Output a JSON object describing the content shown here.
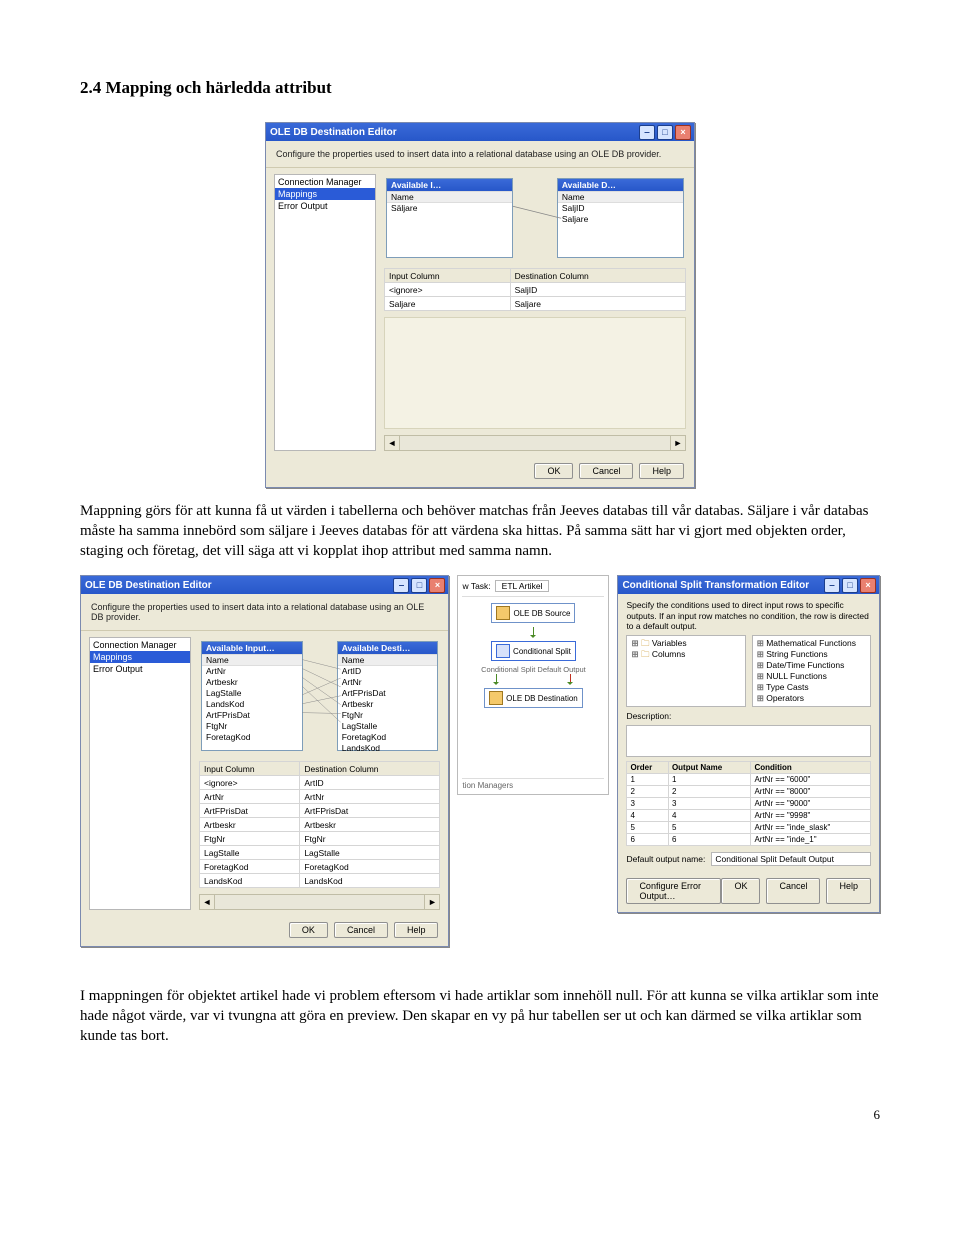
{
  "heading": "2.4 Mapping och härledda attribut",
  "para1": "Mappning görs för att kunna få ut värden i tabellerna och behöver matchas från Jeeves databas till vår databas. Säljare i vår databas måste ha samma innebörd som säljare i Jeeves databas för att värdena ska hittas. På samma sätt har vi gjort med objekten order, staging och företag, det vill säga att vi kopplat ihop attribut med samma namn.",
  "para2": "I mappningen för objektet artikel hade vi problem eftersom vi hade artiklar som innehöll null. För att kunna se vilka artiklar som inte hade något värde, var vi tvungna att göra en preview. Den skapar en vy på hur tabellen ser ut och kan därmed se vilka artiklar som kunde tas bort.",
  "pagenum": "6",
  "window_title": "OLE DB Destination Editor",
  "instruction": "Configure the properties used to insert data into a relational database using an OLE DB provider.",
  "sidebar": {
    "items": [
      {
        "label": "Connection Manager"
      },
      {
        "label": "Mappings"
      },
      {
        "label": "Error Output"
      }
    ]
  },
  "avail_input_hdr": "Available I…",
  "avail_input_full": "Available Input…",
  "avail_dest_hdr": "Available D…",
  "avail_dest_full": "Available Desti…",
  "name_hdr": "Name",
  "top_input_items": [
    {
      "label": "Säljare"
    }
  ],
  "top_dest_items": [
    {
      "label": "SaljID"
    },
    {
      "label": "Saljare"
    }
  ],
  "map_cols": {
    "input": "Input Column",
    "dest": "Destination Column"
  },
  "top_map_rows": [
    {
      "input": "<ignore>",
      "dest": "SaljID"
    },
    {
      "input": "Saljare",
      "dest": "Saljare"
    }
  ],
  "btn_ok": "OK",
  "btn_cancel": "Cancel",
  "btn_help": "Help",
  "bl_input_items": [
    {
      "label": "ArtNr"
    },
    {
      "label": "Artbeskr"
    },
    {
      "label": "LagStalle"
    },
    {
      "label": "LandsKod"
    },
    {
      "label": "ArtFPrisDat"
    },
    {
      "label": "FtgNr"
    },
    {
      "label": "ForetagKod"
    }
  ],
  "bl_dest_items": [
    {
      "label": "ArtID"
    },
    {
      "label": "ArtNr"
    },
    {
      "label": "ArtFPrisDat"
    },
    {
      "label": "Artbeskr"
    },
    {
      "label": "FtgNr"
    },
    {
      "label": "LagStalle"
    },
    {
      "label": "ForetagKod"
    },
    {
      "label": "LandsKod"
    }
  ],
  "bl_map_rows": [
    {
      "input": "<ignore>",
      "dest": "ArtID"
    },
    {
      "input": "ArtNr",
      "dest": "ArtNr"
    },
    {
      "input": "ArtFPrisDat",
      "dest": "ArtFPrisDat"
    },
    {
      "input": "Artbeskr",
      "dest": "Artbeskr"
    },
    {
      "input": "FtgNr",
      "dest": "FtgNr"
    },
    {
      "input": "LagStalle",
      "dest": "LagStalle"
    },
    {
      "input": "ForetagKod",
      "dest": "ForetagKod"
    },
    {
      "input": "LandsKod",
      "dest": "LandsKod"
    }
  ],
  "flow": {
    "task_prefix": "w Task:",
    "task_label": "ETL Artikel",
    "src": "OLE DB Source",
    "split": "Conditional Split",
    "dest": "OLE DB Destination",
    "default_output": "Conditional Split Default Output",
    "managers": "tion Managers"
  },
  "cond": {
    "title": "Conditional Split Transformation Editor",
    "desc": "Specify the conditions used to direct input rows to specific outputs. If an input row matches no condition, the row is directed to a default output.",
    "left": [
      {
        "label": "Variables"
      },
      {
        "label": "Columns"
      }
    ],
    "right": [
      {
        "label": "Mathematical Functions"
      },
      {
        "label": "String Functions"
      },
      {
        "label": "Date/Time Functions"
      },
      {
        "label": "NULL Functions"
      },
      {
        "label": "Type Casts"
      },
      {
        "label": "Operators"
      }
    ],
    "description_label": "Description:",
    "cols": {
      "order": "Order",
      "out": "Output Name",
      "cond": "Condition"
    },
    "rows": [
      {
        "order": "1",
        "out": "1",
        "cond": "ArtNr == \"6000\""
      },
      {
        "order": "2",
        "out": "2",
        "cond": "ArtNr == \"8000\""
      },
      {
        "order": "3",
        "out": "3",
        "cond": "ArtNr == \"9000\""
      },
      {
        "order": "4",
        "out": "4",
        "cond": "ArtNr == \"9998\""
      },
      {
        "order": "5",
        "out": "5",
        "cond": "ArtNr == \"inde_slask\""
      },
      {
        "order": "6",
        "out": "6",
        "cond": "ArtNr == \"inde_1\""
      }
    ],
    "default_name_label": "Default output name:",
    "default_name_value": "Conditional Split Default Output",
    "configure_error": "Configure Error Output…"
  }
}
